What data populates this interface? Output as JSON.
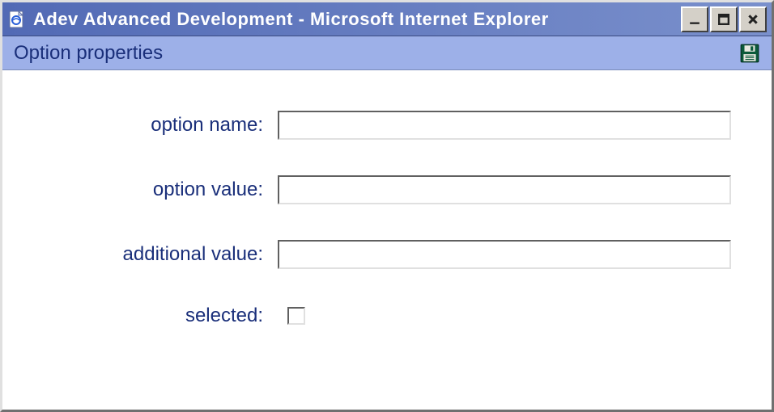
{
  "window": {
    "title": "Adev Advanced Development - Microsoft Internet Explorer"
  },
  "panel": {
    "title": "Option properties"
  },
  "form": {
    "option_name": {
      "label": "option name:",
      "value": ""
    },
    "option_value": {
      "label": "option value:",
      "value": ""
    },
    "additional_value": {
      "label": "additional value:",
      "value": ""
    },
    "selected": {
      "label": "selected:",
      "checked": false
    }
  },
  "icons": {
    "app": "ie-page-icon",
    "save": "floppy-disk-icon"
  }
}
